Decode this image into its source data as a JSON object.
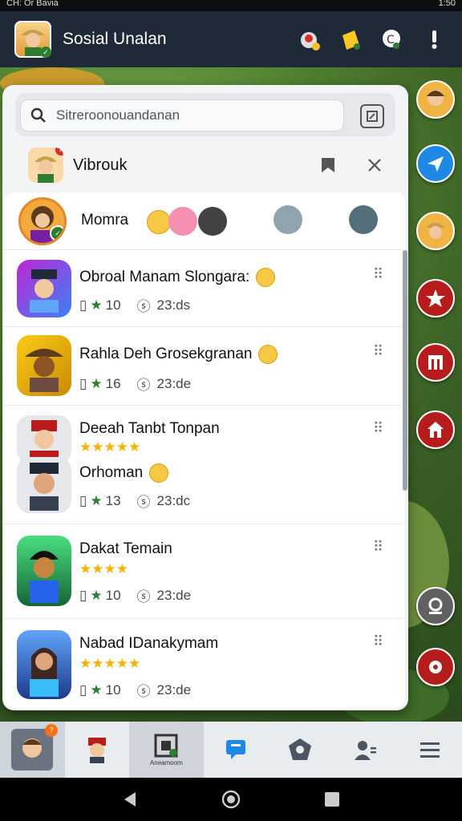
{
  "status_bar": {
    "left_text": "CH: Or Bavia",
    "right_text": "1:50"
  },
  "app": {
    "title": "Sosial Unalan"
  },
  "search": {
    "placeholder": "Sitreroonouandanan"
  },
  "panel_header": {
    "title": "Vibrouk"
  },
  "first_row": {
    "name": "Momra"
  },
  "rows": [
    {
      "name": "Obroal Manam Slongara:",
      "has_emoji": true,
      "level": "10",
      "time": "23:ds",
      "stars": ""
    },
    {
      "name": "Rahla Deh Grosekgranan",
      "has_emoji": true,
      "level": "16",
      "time": "23:de",
      "stars": ""
    },
    {
      "name": "Deeah Tanbt Tonpan",
      "stars": "★★★★★",
      "subname": "Orhoman",
      "level": "13",
      "time": "23:dc"
    },
    {
      "name": "Dakat Temain",
      "stars": "★★★★",
      "level": "10",
      "time": "23:de"
    },
    {
      "name": "Nabad IDanakymam",
      "stars": "★★★★★",
      "level": "10",
      "time": "23:de"
    }
  ],
  "bottom_nav": {
    "badge_count": "7",
    "active_caption": "Aneamoom"
  },
  "colors": {
    "accent": "#1e88e5",
    "app_bar": "#1f2937",
    "rank_red": "#b71c1c"
  }
}
